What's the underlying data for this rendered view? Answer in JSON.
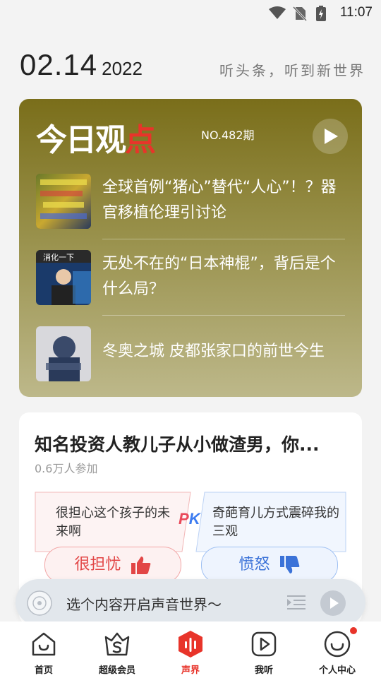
{
  "status_bar": {
    "time": "11:07"
  },
  "date": {
    "day": "02.14",
    "year": "2022",
    "slogan": "听头条，听到新世界"
  },
  "today_card": {
    "brand_left": "今日观",
    "brand_right": "点",
    "issue": "NO.482期",
    "items": [
      {
        "title": "全球首例“猪心”替代“人心”！？器官移植伦理引讨论"
      },
      {
        "title": "无处不在的“日本神棍”，背后是个什么局？"
      },
      {
        "title": "冬奥之城 皮都张家口的前世今生"
      }
    ],
    "thumb_texts": [
      "消化一下"
    ]
  },
  "pk_card": {
    "title": "知名投资人教儿子从小做渣男，你...",
    "participants": "0.6万人参加",
    "left_opinion": "很担心这个孩子的未来啊",
    "right_opinion": "奇葩育儿方式震碎我的三观",
    "pk_p": "P",
    "pk_k": "K",
    "vote_worry": "很担忧",
    "vote_angry": "愤怒"
  },
  "player": {
    "prompt": "选个内容开启声音世界～"
  },
  "tabs": [
    {
      "label": "首页",
      "icon": "home-icon"
    },
    {
      "label": "超级会员",
      "icon": "vip-icon"
    },
    {
      "label": "声界",
      "icon": "soundworld-icon"
    },
    {
      "label": "我听",
      "icon": "my-listen-icon"
    },
    {
      "label": "个人中心",
      "icon": "profile-icon"
    }
  ],
  "colors": {
    "accent": "#e8342a",
    "card_olive": "#7a6e1a",
    "pk_red": "#e24646",
    "pk_blue": "#3b72d8"
  }
}
